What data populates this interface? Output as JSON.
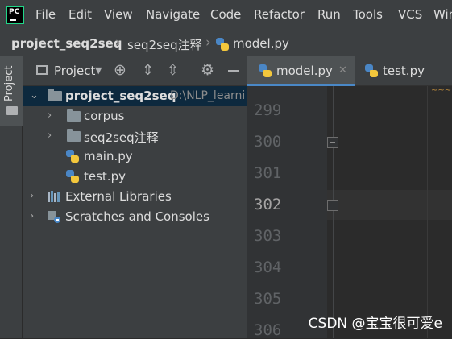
{
  "menu": [
    "File",
    "Edit",
    "View",
    "Navigate",
    "Code",
    "Refactor",
    "Run",
    "Tools",
    "VCS",
    "Win"
  ],
  "breadcrumb": [
    "project_seq2seq",
    "seq2seq注释",
    "model.py"
  ],
  "side_tab": {
    "label": "Project"
  },
  "project_panel": {
    "title": "Project"
  },
  "tree": {
    "root": {
      "name": "project_seq2seq",
      "path": "D:\\NLP_learni"
    },
    "folders": [
      "corpus",
      "seq2seq注释"
    ],
    "files": [
      "main.py",
      "test.py"
    ],
    "external_libraries": "External Libraries",
    "scratches": "Scratches and Consoles"
  },
  "tabs": [
    {
      "label": "model.py",
      "active": true
    },
    {
      "label": "test.py",
      "active": false
    }
  ],
  "editor": {
    "line_numbers": [
      "299",
      "300",
      "301",
      "302",
      "303",
      "304",
      "305",
      "306"
    ],
    "current_line": "302"
  },
  "watermark": "CSDN @宝宝很可爱e",
  "colors": {
    "accent": "#4a88c7",
    "selection": "#0d293e",
    "background": "#2b2b2b"
  }
}
